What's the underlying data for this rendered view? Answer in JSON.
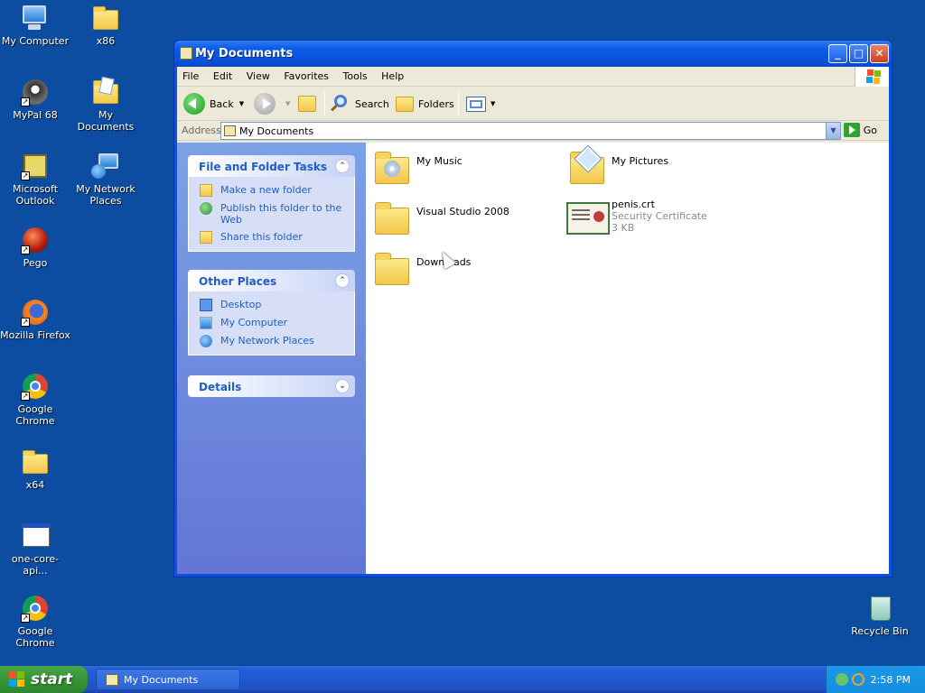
{
  "desktop": {
    "icons": [
      {
        "label": "My Computer",
        "icon": "my-computer-icon"
      },
      {
        "label": "x86",
        "icon": "folder-icon"
      },
      {
        "label": "MyPal 68",
        "icon": "mypal-icon"
      },
      {
        "label": "My Documents",
        "icon": "my-documents-icon"
      },
      {
        "label": "Microsoft Outlook",
        "icon": "outlook-icon"
      },
      {
        "label": "My Network Places",
        "icon": "network-places-icon"
      },
      {
        "label": "Pego",
        "icon": "pego-icon"
      },
      {
        "label": "Mozilla Firefox",
        "icon": "firefox-icon"
      },
      {
        "label": "Google Chrome",
        "icon": "chrome-icon"
      },
      {
        "label": "x64",
        "icon": "folder-icon"
      },
      {
        "label": "one-core-api...",
        "icon": "window-app-icon"
      },
      {
        "label": "Google Chrome",
        "icon": "chrome-icon"
      },
      {
        "label": "Recycle Bin",
        "icon": "recycle-bin-icon"
      }
    ]
  },
  "window": {
    "title": "My Documents",
    "menu": [
      "File",
      "Edit",
      "View",
      "Favorites",
      "Tools",
      "Help"
    ],
    "toolbar": {
      "back": "Back",
      "search": "Search",
      "folders": "Folders"
    },
    "address": {
      "label": "Address",
      "value": "My Documents",
      "go": "Go"
    },
    "panels": {
      "tasks": {
        "title": "File and Folder Tasks",
        "items": [
          "Make a new folder",
          "Publish this folder to the Web",
          "Share this folder"
        ]
      },
      "other": {
        "title": "Other Places",
        "items": [
          "Desktop",
          "My Computer",
          "My Network Places"
        ]
      },
      "details": {
        "title": "Details"
      }
    },
    "items": [
      {
        "name": "My Music",
        "icon": "music-folder-icon"
      },
      {
        "name": "My Pictures",
        "icon": "pictures-folder-icon"
      },
      {
        "name": "Visual Studio 2008",
        "icon": "folder-icon"
      },
      {
        "name": "penis.crt",
        "type": "Security Certificate",
        "size": "3 KB",
        "icon": "certificate-icon"
      },
      {
        "name": "Downloads",
        "icon": "folder-icon"
      }
    ]
  },
  "taskbar": {
    "start": "start",
    "task": "My Documents",
    "clock": "2:58 PM"
  }
}
